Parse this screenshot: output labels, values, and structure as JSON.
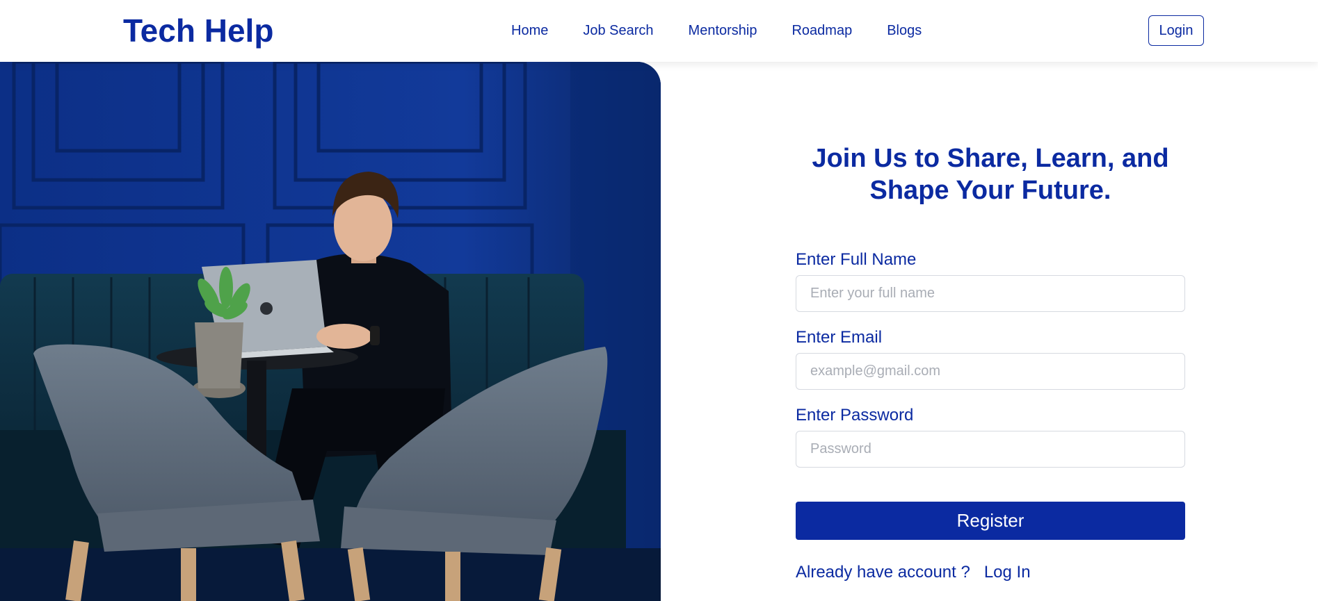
{
  "brand": {
    "name": "Tech Help"
  },
  "nav": {
    "items": [
      {
        "label": "Home"
      },
      {
        "label": "Job Search"
      },
      {
        "label": "Mentorship"
      },
      {
        "label": "Roadmap"
      },
      {
        "label": "Blogs"
      }
    ],
    "login_label": "Login"
  },
  "hero": {
    "image_semantic": "man-working-on-laptop-photo"
  },
  "form": {
    "heading": "Join Us to Share, Learn, and Shape Your Future.",
    "full_name": {
      "label": "Enter Full Name",
      "placeholder": "Enter your full name",
      "value": ""
    },
    "email": {
      "label": "Enter Email",
      "placeholder": "example@gmail.com",
      "value": ""
    },
    "password": {
      "label": "Enter Password",
      "placeholder": "Password",
      "value": ""
    },
    "register_label": "Register",
    "account_prompt": "Already have account ?",
    "login_link": "Log In"
  },
  "colors": {
    "brand": "#0b2aa1",
    "input_border": "#d6d9e0",
    "placeholder": "#a9adb5",
    "background": "#ffffff"
  }
}
